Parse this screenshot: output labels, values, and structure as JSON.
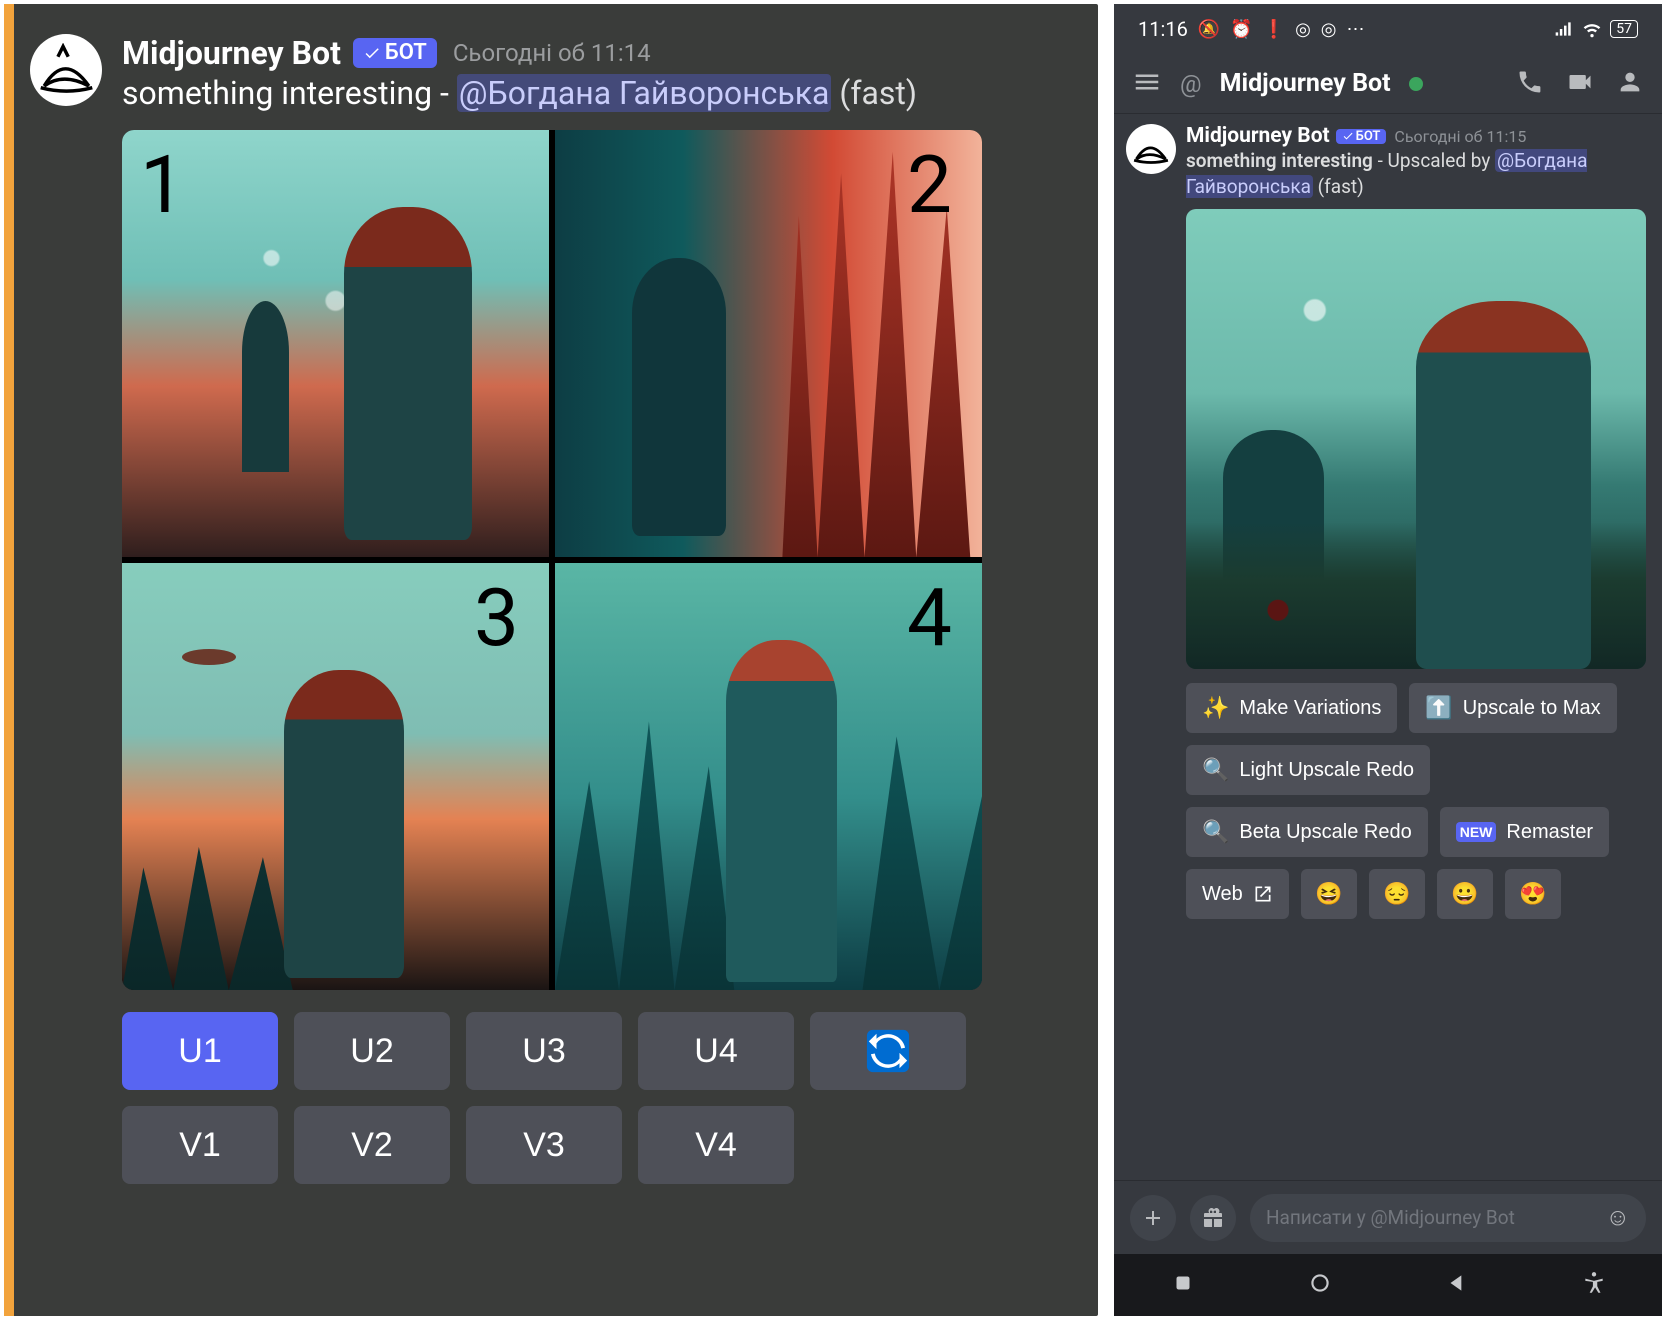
{
  "left": {
    "author": "Midjourney Bot",
    "bot_tag": "БОТ",
    "timestamp": "Сьогодні об 11:14",
    "prompt_prefix": "something interesting - ",
    "mention": "@Богдана Гайворонська",
    "prompt_suffix": " (fast)",
    "tiles": [
      "1",
      "2",
      "3",
      "4"
    ],
    "buttons_row1": [
      "U1",
      "U2",
      "U3",
      "U4"
    ],
    "buttons_row2": [
      "V1",
      "V2",
      "V3",
      "V4"
    ],
    "reroll_icon": "reroll-icon"
  },
  "right": {
    "status_time": "11:16",
    "status_battery": "57",
    "channel_at": "@",
    "channel_title": "Midjourney Bot",
    "author": "Midjourney Bot",
    "bot_tag": "БОТ",
    "timestamp": "Сьогодні об 11:15",
    "prompt_prefix": "something interesting",
    "upscaled_by": " - Upscaled by ",
    "mention": "@Богдана Гайворонська",
    "prompt_suffix": " (fast)",
    "actions": {
      "make_variations": "Make Variations",
      "upscale_max": "Upscale to Max",
      "light_redo": "Light Upscale Redo",
      "beta_redo": "Beta Upscale Redo",
      "remaster_badge": "NEW",
      "remaster": "Remaster",
      "web": "Web"
    },
    "reactions": [
      "😆",
      "😔",
      "😀",
      "😍"
    ],
    "composer_placeholder": "Написати у @Midjourney Bot"
  }
}
